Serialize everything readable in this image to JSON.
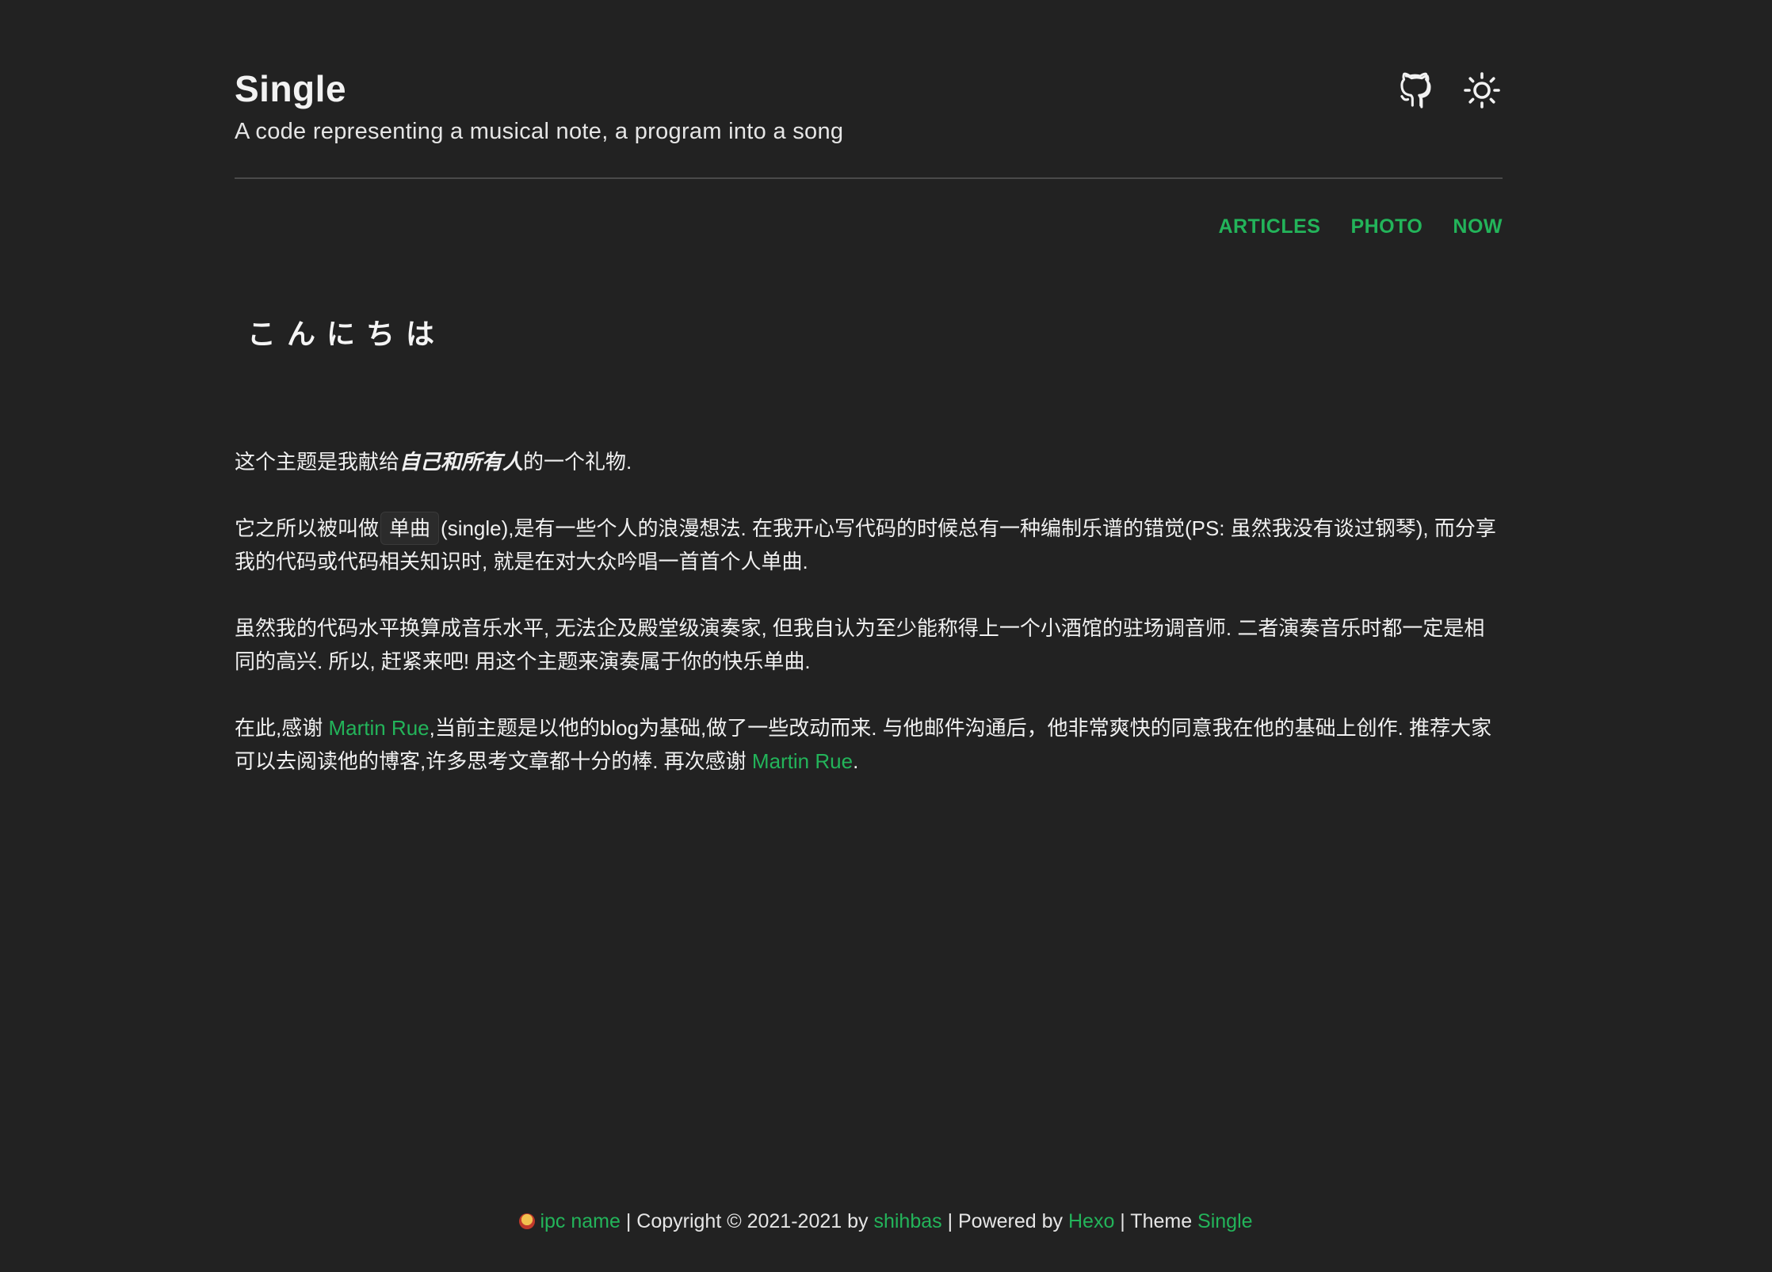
{
  "header": {
    "title": "Single",
    "subtitle": "A code representing a musical note, a program into a song",
    "icons": [
      "github-icon",
      "sun-icon"
    ]
  },
  "nav": {
    "items": [
      "ARTICLES",
      "PHOTO",
      "NOW"
    ]
  },
  "main": {
    "greeting": "こんにちは",
    "p1": {
      "prefix": "这个主题是我献给",
      "emphasis": "自己和所有人",
      "suffix": "的一个礼物."
    },
    "p2": {
      "prefix": "它之所以被叫做",
      "tag": "单曲",
      "suffix": "(single),是有一些个人的浪漫想法. 在我开心写代码的时候总有一种编制乐谱的错觉(PS: 虽然我没有谈过钢琴), 而分享我的代码或代码相关知识时, 就是在对大众吟唱一首首个人单曲."
    },
    "p3": {
      "text": "虽然我的代码水平换算成音乐水平, 无法企及殿堂级演奏家, 但我自认为至少能称得上一个小酒馆的驻场调音师. 二者演奏音乐时都一定是相同的高兴. 所以, 赶紧来吧! 用这个主题来演奏属于你的快乐单曲."
    },
    "p4": {
      "prefix": "在此,感谢 ",
      "link1": "Martin Rue",
      "middle": ",当前主题是以他的blog为基础,做了一些改动而来. 与他邮件沟通后，他非常爽快的同意我在他的基础上创作. 推荐大家可以去阅读他的博客,许多思考文章都十分的棒. 再次感谢 ",
      "link2": "Martin Rue",
      "suffix": "."
    }
  },
  "footer": {
    "icp_link": "ipc name",
    "copyright": " | Copyright © 2021-2021 by ",
    "author_link": "shihbas",
    "powered": " | Powered by ",
    "hexo_link": "Hexo",
    "theme": " | Theme ",
    "theme_link": "Single"
  },
  "colors": {
    "background": "#222222",
    "accent": "#23b45a",
    "text": "#f0f0f0"
  }
}
